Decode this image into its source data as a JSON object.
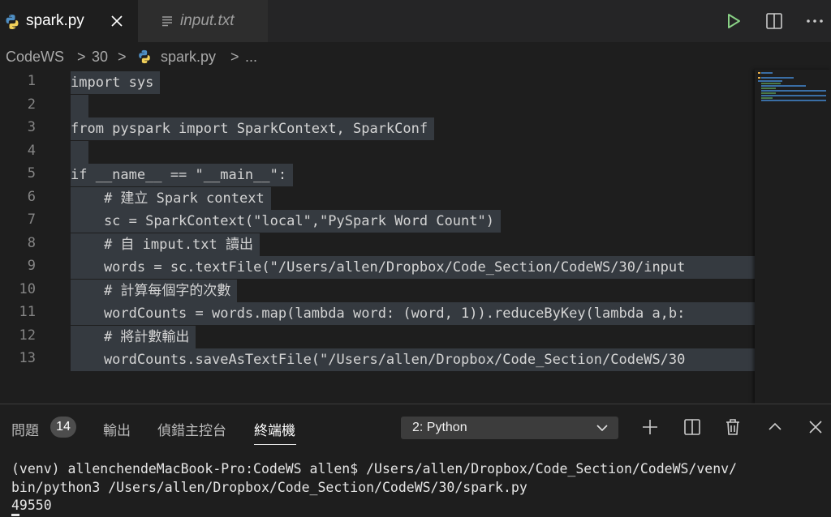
{
  "tabs": [
    {
      "label": "spark.py",
      "icon": "python-icon",
      "active": true
    },
    {
      "label": "input.txt",
      "icon": "text-file-icon",
      "active": false
    }
  ],
  "breadcrumb": {
    "parts": [
      "CodeWS",
      "30",
      "spark.py",
      "..."
    ],
    "separator": ">"
  },
  "editor": {
    "line_numbers": [
      "1",
      "2",
      "3",
      "4",
      "5",
      "6",
      "7",
      "8",
      "9",
      "10",
      "11",
      "12",
      "13"
    ],
    "lines": [
      "import sys",
      "",
      "from pyspark import SparkContext, SparkConf",
      "",
      "if __name__ == \"__main__\":",
      "    # 建立 Spark context",
      "    sc = SparkContext(\"local\",\"PySpark Word Count\")",
      "    # 自 imput.txt 讀出",
      "    words = sc.textFile(\"/Users/allen/Dropbox/Code_Section/CodeWS/30/input",
      "    # 計算每個字的次數",
      "    wordCounts = words.map(lambda word: (word, 1)).reduceByKey(lambda a,b:",
      "    # 將計數輸出",
      "    wordCounts.saveAsTextFile(\"/Users/allen/Dropbox/Code_Section/CodeWS/30"
    ]
  },
  "panel": {
    "tabs": [
      "問題",
      "輸出",
      "偵錯主控台",
      "終端機"
    ],
    "problems_count": "14",
    "active_tab": "終端機",
    "terminal_select": "2: Python",
    "terminal_lines": [
      "(venv) allenchendeMacBook-Pro:CodeWS allen$ /Users/allen/Dropbox/Code_Section/CodeWS/venv/",
      "bin/python3 /Users/allen/Dropbox/Code_Section/CodeWS/30/spark.py",
      "49550"
    ]
  },
  "colors": {
    "keyword": "#569cd6",
    "string": "#ce9178",
    "comment": "#6a9955",
    "number": "#b5cea8",
    "run": "#89d185"
  }
}
